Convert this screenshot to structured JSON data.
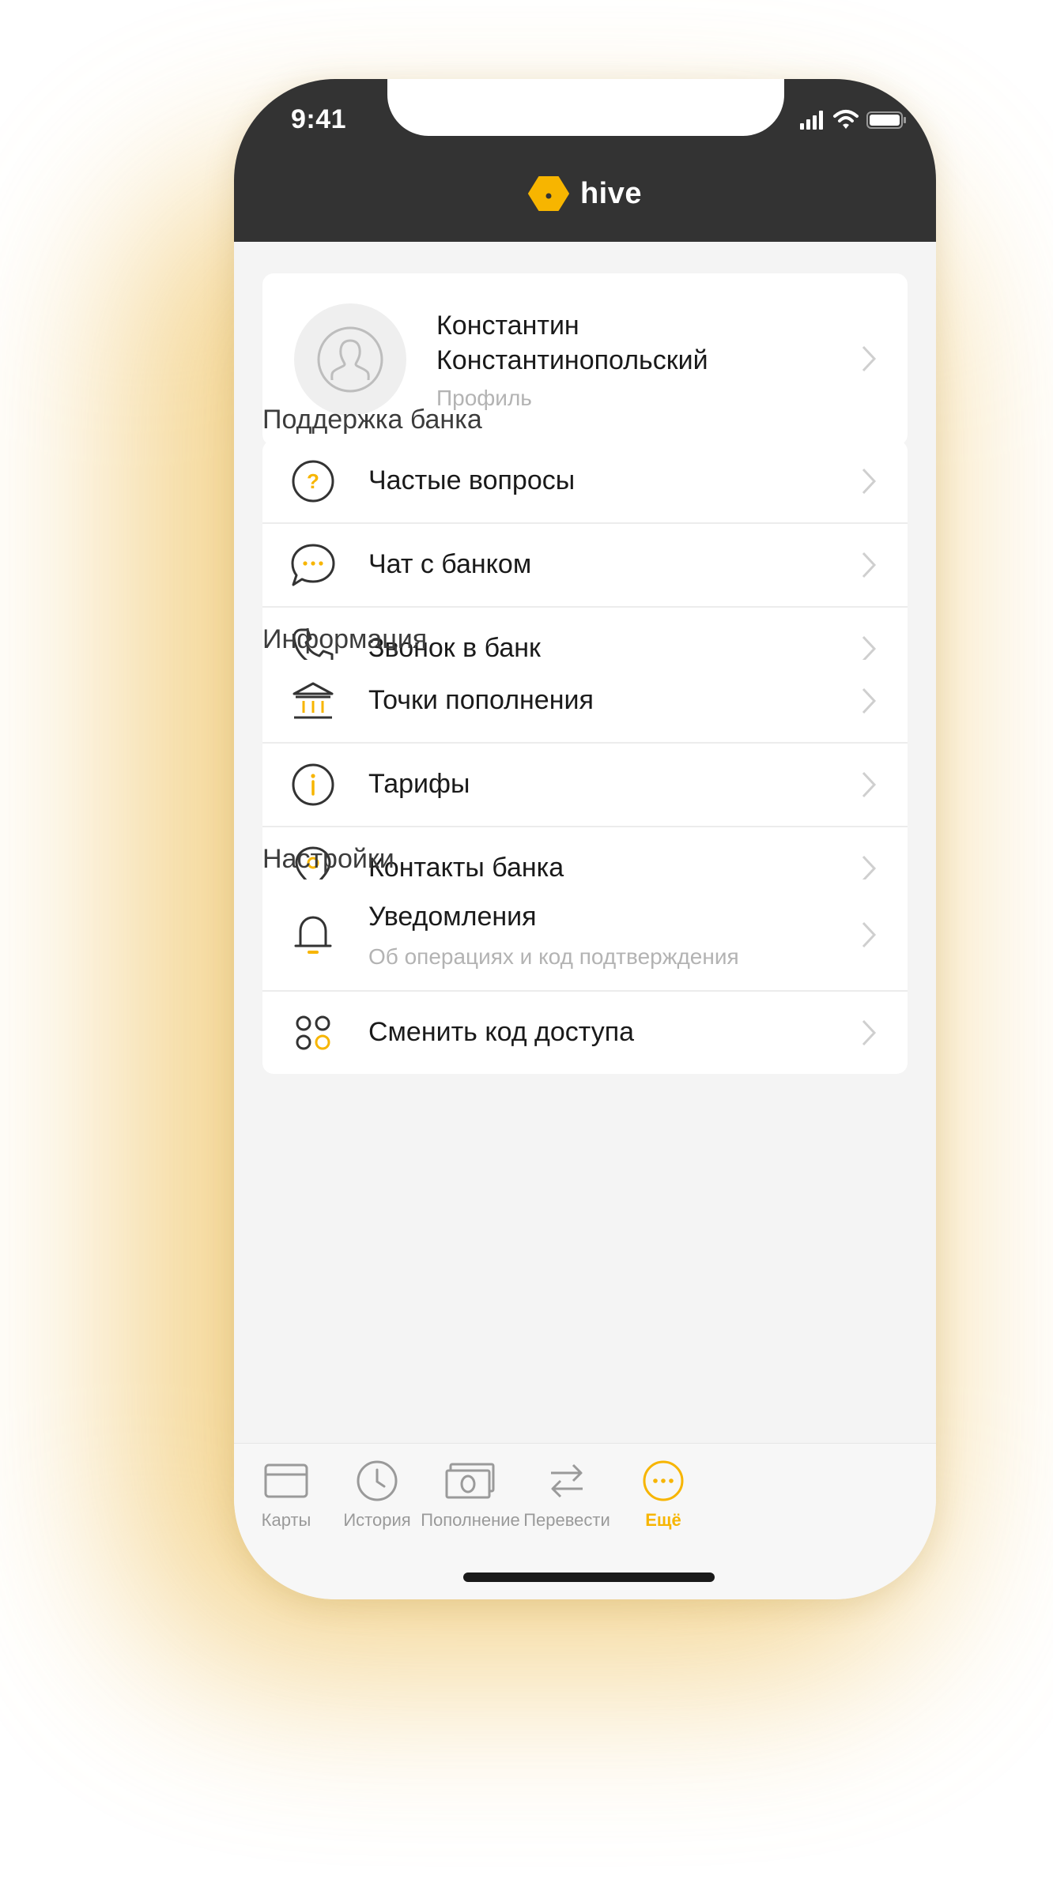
{
  "status_bar": {
    "time": "9:41"
  },
  "header": {
    "logo_text": "hive"
  },
  "profile": {
    "name": "Константин Константинопольский",
    "subtitle": "Профиль"
  },
  "sections": [
    {
      "title": "Поддержка банка",
      "items": [
        {
          "label": "Частые вопросы",
          "icon": "question-icon"
        },
        {
          "label": "Чат с банком",
          "icon": "chat-icon"
        },
        {
          "label": "Звонок в банк",
          "icon": "phone-icon"
        }
      ]
    },
    {
      "title": "Информация",
      "items": [
        {
          "label": "Точки пополнения",
          "icon": "bank-icon"
        },
        {
          "label": "Тарифы",
          "icon": "info-icon"
        },
        {
          "label": "Контакты банка",
          "icon": "location-pin-icon"
        }
      ]
    },
    {
      "title": "Настройки",
      "items": [
        {
          "label": "Уведомления",
          "sublabel": "Об операциях и код подтверждения",
          "icon": "bell-icon"
        },
        {
          "label": "Сменить код доступа",
          "icon": "passcode-icon"
        }
      ]
    }
  ],
  "tabbar": {
    "tabs": [
      {
        "label": "Карты",
        "icon": "card-icon"
      },
      {
        "label": "История",
        "icon": "clock-icon"
      },
      {
        "label": "Пополнение",
        "icon": "cash-icon"
      },
      {
        "label": "Перевести",
        "icon": "transfer-icon"
      },
      {
        "label": "Ещё",
        "icon": "more-icon"
      }
    ],
    "active_tab": "Ещё"
  },
  "colors": {
    "accent": "#F7B500",
    "header_bg": "#333333",
    "glow": "#F0C66A"
  }
}
